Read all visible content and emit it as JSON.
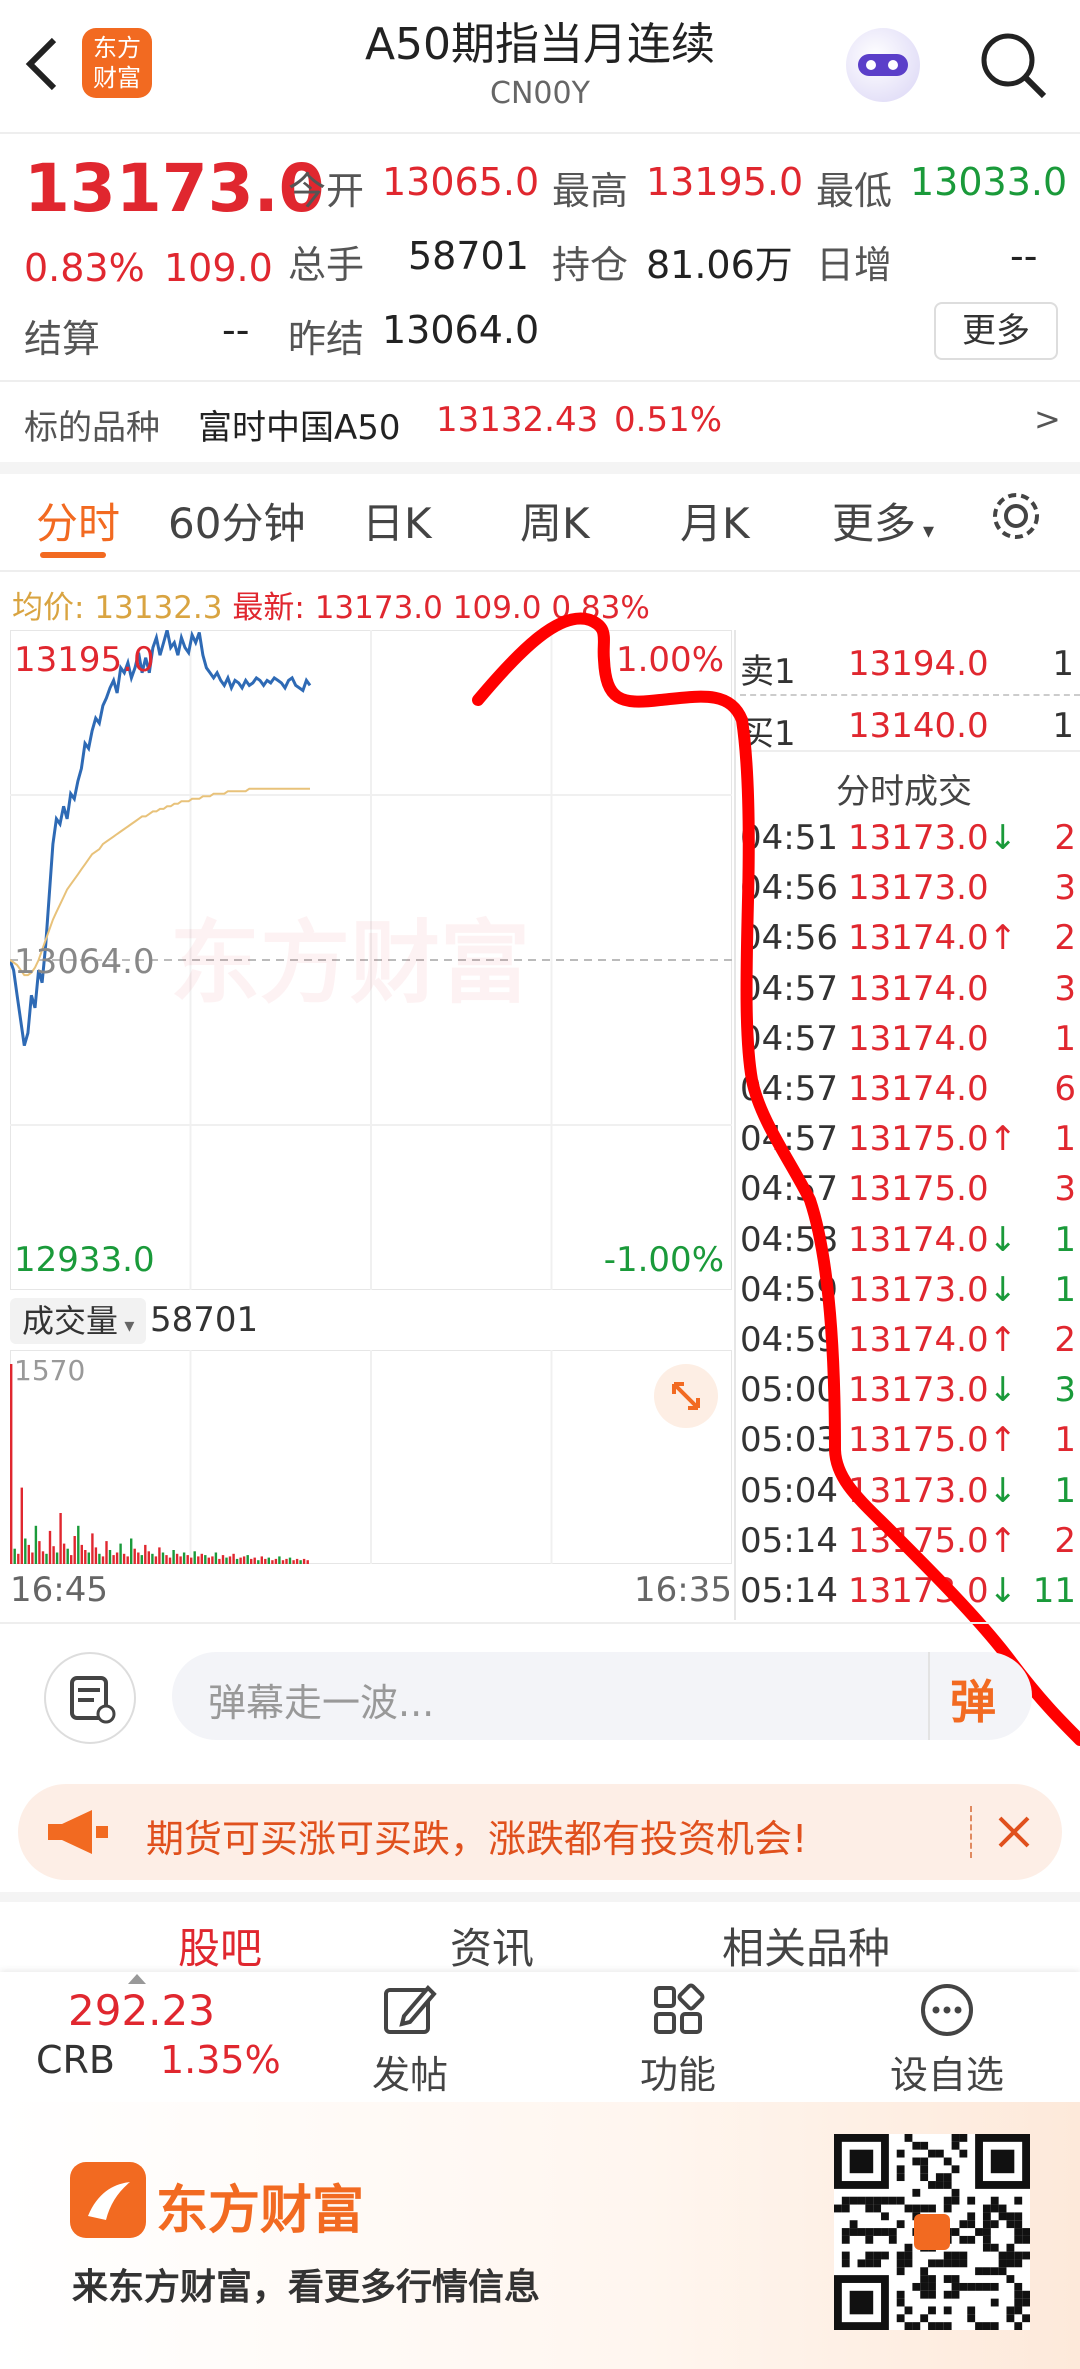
{
  "header": {
    "title": "A50期指当月连续",
    "code": "CN00Y",
    "logo_text": "东方财富",
    "back_icon": "back-icon",
    "search_icon": "search-icon"
  },
  "quote": {
    "price": "13173.0",
    "change_pct": "0.83%",
    "change": "109.0",
    "open_label": "今开",
    "open": "13065.0",
    "high_label": "最高",
    "high": "13195.0",
    "low_label": "最低",
    "low": "13033.0",
    "volume_label": "总手",
    "volume": "58701",
    "oi_label": "持仓",
    "oi": "81.06万",
    "daily_inc_label": "日增",
    "daily_inc": "--",
    "settle_label": "结算",
    "settle": "--",
    "prev_settle_label": "昨结",
    "prev_settle": "13064.0",
    "more_label": "更多"
  },
  "underlying": {
    "label": "标的品种",
    "name": "富时中国A50",
    "price": "13132.43",
    "pct": "0.51%",
    "arrow": ">"
  },
  "tabs": [
    "分时",
    "60分钟",
    "日K",
    "周K",
    "月K",
    "更多"
  ],
  "chart_info": {
    "avg_label": "均价:",
    "avg": "13132.3",
    "latest_label": "最新:",
    "latest": "13173.0",
    "change": "109.0",
    "pct": "0.83%"
  },
  "chart_data": {
    "type": "line",
    "y_axis_left": [
      "13195.0",
      "13064.0",
      "12933.0"
    ],
    "y_axis_right": [
      "1.00%",
      "-1.00%"
    ],
    "ylim": [
      12933.0,
      13195.0
    ],
    "x_labels": [
      "16:45",
      "16:35"
    ],
    "watermark": "东方财富",
    "series": [
      {
        "name": "price",
        "color": "#2e6ab5",
        "values": [
          13064,
          13060,
          13050,
          13040,
          13030,
          13035,
          13050,
          13045,
          13060,
          13055,
          13070,
          13090,
          13110,
          13120,
          13118,
          13125,
          13120,
          13130,
          13128,
          13135,
          13140,
          13150,
          13148,
          13155,
          13160,
          13158,
          13165,
          13168,
          13172,
          13175,
          13170,
          13180,
          13178,
          13182,
          13176,
          13180,
          13186,
          13178,
          13184,
          13178,
          13188,
          13192,
          13185,
          13190,
          13195,
          13188,
          13190,
          13185,
          13192,
          13188,
          13186,
          13193,
          13190,
          13194,
          13185,
          13180,
          13178,
          13176,
          13178,
          13175,
          13173,
          13176,
          13172,
          13175,
          13174,
          13172,
          13175,
          13173,
          13174,
          13176,
          13175,
          13173,
          13175,
          13174,
          13176,
          13175,
          13174,
          13172,
          13175,
          13176,
          13173,
          13172,
          13171,
          13175,
          13173
        ]
      },
      {
        "name": "avg",
        "color": "#e8c27a",
        "values": [
          13064,
          13063,
          13062,
          13060,
          13058,
          13058,
          13059,
          13061,
          13064,
          13068,
          13072,
          13076,
          13080,
          13083,
          13086,
          13089,
          13092,
          13094,
          13096,
          13098,
          13100,
          13102,
          13104,
          13106,
          13107,
          13108,
          13110,
          13111,
          13112,
          13113,
          13114,
          13115,
          13116,
          13117,
          13118,
          13119,
          13120,
          13121,
          13121,
          13122,
          13123,
          13123,
          13124,
          13124,
          13125,
          13125,
          13126,
          13126,
          13127,
          13127,
          13127,
          13128,
          13128,
          13128,
          13129,
          13129,
          13129,
          13130,
          13130,
          13130,
          13130,
          13131,
          13131,
          13131,
          13131,
          13131,
          13131,
          13132,
          13132,
          13132,
          13132,
          13132,
          13132,
          13132,
          13132,
          13132,
          13132,
          13132,
          13132,
          13132,
          13132,
          13132,
          13132,
          13132,
          13132
        ]
      }
    ],
    "volume": {
      "label": "成交量",
      "total": "58701",
      "max_label": "1570",
      "values": [
        1570,
        120,
        80,
        600,
        200,
        150,
        90,
        300,
        180,
        100,
        80,
        260,
        140,
        90,
        400,
        160,
        120,
        70,
        220,
        300,
        150,
        110,
        90,
        240,
        130,
        80,
        60,
        180,
        110,
        70,
        90,
        160,
        80,
        60,
        200,
        120,
        90,
        70,
        150,
        100,
        80,
        60,
        130,
        90,
        70,
        50,
        110,
        80,
        60,
        90,
        70,
        50,
        100,
        60,
        80,
        70,
        50,
        60,
        90,
        40,
        70,
        50,
        60,
        80,
        40,
        50,
        60,
        70,
        40,
        50,
        30,
        60,
        40,
        50,
        30,
        40,
        60,
        30,
        40,
        50,
        30,
        40,
        30,
        40,
        30
      ]
    }
  },
  "order_book": {
    "sell_label": "卖1",
    "sell_price": "13194.0",
    "sell_vol": "1",
    "buy_label": "买1",
    "buy_price": "13140.0",
    "buy_vol": "1",
    "trades_title": "分时成交",
    "trades": [
      {
        "time": "04:51",
        "price": "13173.0",
        "dir": "↓",
        "vol": "2",
        "vol_color": "red"
      },
      {
        "time": "04:56",
        "price": "13173.0",
        "dir": "",
        "vol": "3",
        "vol_color": "red"
      },
      {
        "time": "04:56",
        "price": "13174.0",
        "dir": "↑",
        "vol": "2",
        "vol_color": "red"
      },
      {
        "time": "04:57",
        "price": "13174.0",
        "dir": "",
        "vol": "3",
        "vol_color": "red"
      },
      {
        "time": "04:57",
        "price": "13174.0",
        "dir": "",
        "vol": "1",
        "vol_color": "red"
      },
      {
        "time": "04:57",
        "price": "13174.0",
        "dir": "",
        "vol": "6",
        "vol_color": "red"
      },
      {
        "time": "04:57",
        "price": "13175.0",
        "dir": "↑",
        "vol": "1",
        "vol_color": "red"
      },
      {
        "time": "04:57",
        "price": "13175.0",
        "dir": "",
        "vol": "3",
        "vol_color": "red"
      },
      {
        "time": "04:58",
        "price": "13174.0",
        "dir": "↓",
        "vol": "1",
        "vol_color": "green"
      },
      {
        "time": "04:59",
        "price": "13173.0",
        "dir": "↓",
        "vol": "1",
        "vol_color": "green"
      },
      {
        "time": "04:59",
        "price": "13174.0",
        "dir": "↑",
        "vol": "2",
        "vol_color": "red"
      },
      {
        "time": "05:00",
        "price": "13173.0",
        "dir": "↓",
        "vol": "3",
        "vol_color": "green"
      },
      {
        "time": "05:03",
        "price": "13175.0",
        "dir": "↑",
        "vol": "1",
        "vol_color": "red"
      },
      {
        "time": "05:04",
        "price": "13173.0",
        "dir": "↓",
        "vol": "1",
        "vol_color": "green"
      },
      {
        "time": "05:14",
        "price": "13175.0",
        "dir": "↑",
        "vol": "2",
        "vol_color": "red"
      },
      {
        "time": "05:14",
        "price": "13173.0",
        "dir": "↓",
        "vol": "11",
        "vol_color": "green"
      }
    ]
  },
  "danmaku": {
    "placeholder": "弹幕走一波...",
    "button": "弹"
  },
  "promo": {
    "text": "期货可买涨可买跌，涨跌都有投资机会!"
  },
  "bottom_tabs": [
    "股吧",
    "资讯",
    "相关品种"
  ],
  "bottom_nav": {
    "crb_value": "292.23",
    "crb_label": "CRB",
    "crb_pct": "1.35%",
    "post": "发帖",
    "func": "功能",
    "watch": "设自选"
  },
  "footer": {
    "brand": "东方财富",
    "slogan": "来东方财富，看更多行情信息"
  },
  "colors": {
    "up": "#e0272f",
    "down": "#1a9a3a",
    "accent": "#f26a21",
    "price_line": "#2e6ab5",
    "avg_line": "#e8c27a"
  }
}
